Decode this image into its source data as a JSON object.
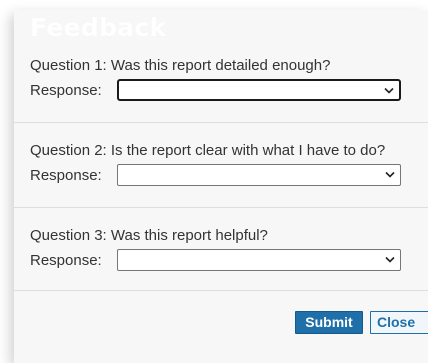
{
  "dialog": {
    "title": "Feedback"
  },
  "questions": [
    {
      "text": "Question 1: Was this report detailed enough?",
      "response_label": "Response:",
      "selected_value": ""
    },
    {
      "text": "Question 2: Is the report clear with what I have to do?",
      "response_label": "Response:",
      "selected_value": ""
    },
    {
      "text": "Question 3: Was this report helpful?",
      "response_label": "Response:",
      "selected_value": ""
    }
  ],
  "buttons": {
    "submit_label": "Submit",
    "close_label": "Close"
  },
  "colors": {
    "accent": "#1f6fa8",
    "background": "#f7f7f7",
    "divider": "#dedede"
  },
  "icons": {
    "select_chevron": "chevron-down-icon"
  }
}
